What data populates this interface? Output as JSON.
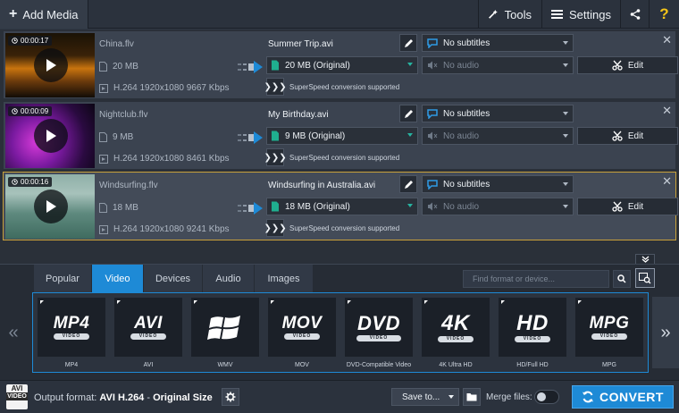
{
  "toolbar": {
    "add_media": "Add Media",
    "tools": "Tools",
    "settings": "Settings",
    "help": "?"
  },
  "files": [
    {
      "duration": "00:00:17",
      "source_name": "China.flv",
      "source_size": "20 MB",
      "source_info": "H.264 1920x1080 9667 Kbps",
      "output_name": "Summer Trip.avi",
      "output_size": "20 MB (Original)",
      "subtitles": "No subtitles",
      "audio": "No audio",
      "superspeed": "SuperSpeed conversion supported",
      "edit_label": "Edit",
      "selected": false
    },
    {
      "duration": "00:00:09",
      "source_name": "Nightclub.flv",
      "source_size": "9 MB",
      "source_info": "H.264 1920x1080 8461 Kbps",
      "output_name": "My Birthday.avi",
      "output_size": "9 MB (Original)",
      "subtitles": "No subtitles",
      "audio": "No audio",
      "superspeed": "SuperSpeed conversion supported",
      "edit_label": "Edit",
      "selected": false
    },
    {
      "duration": "00:00:16",
      "source_name": "Windsurfing.flv",
      "source_size": "18 MB",
      "source_info": "H.264 1920x1080 9241 Kbps",
      "output_name": "Windsurfing in Australia.avi",
      "output_size": "18 MB (Original)",
      "subtitles": "No subtitles",
      "audio": "No audio",
      "superspeed": "SuperSpeed conversion supported",
      "edit_label": "Edit",
      "selected": true
    }
  ],
  "format_tabs": [
    "Popular",
    "Video",
    "Devices",
    "Audio",
    "Images"
  ],
  "active_tab": "Video",
  "search_placeholder": "Find format or device...",
  "formats": [
    {
      "logo": "MP4",
      "sub": "VIDEO",
      "label": "MP4"
    },
    {
      "logo": "AVI",
      "sub": "VIDEO",
      "label": "AVI"
    },
    {
      "logo": "windows-logo",
      "sub": "",
      "label": "WMV"
    },
    {
      "logo": "MOV",
      "sub": "VIDEO",
      "label": "MOV"
    },
    {
      "logo": "DVD",
      "sub": "VIDEO",
      "label": "DVD-Compatible Video"
    },
    {
      "logo": "4K",
      "sub": "VIDEO",
      "label": "4K Ultra HD"
    },
    {
      "logo": "HD",
      "sub": "VIDEO",
      "label": "HD/Full HD"
    },
    {
      "logo": "MPG",
      "sub": "VIDEO",
      "label": "MPG"
    }
  ],
  "bottom": {
    "output_prefix": "Output format: ",
    "output_format": "AVI H.264",
    "output_sep": " - ",
    "output_size_mode": "Original Size",
    "format_icon_top": "AVI",
    "format_icon_band": "VIDEO",
    "save_to": "Save to...",
    "merge_label": "Merge files:",
    "merge_on": false,
    "convert": "CONVERT"
  },
  "colors": {
    "accent": "#1e8ad6",
    "selected_border": "#c9a13a",
    "teal_caret": "#27b3a0"
  }
}
